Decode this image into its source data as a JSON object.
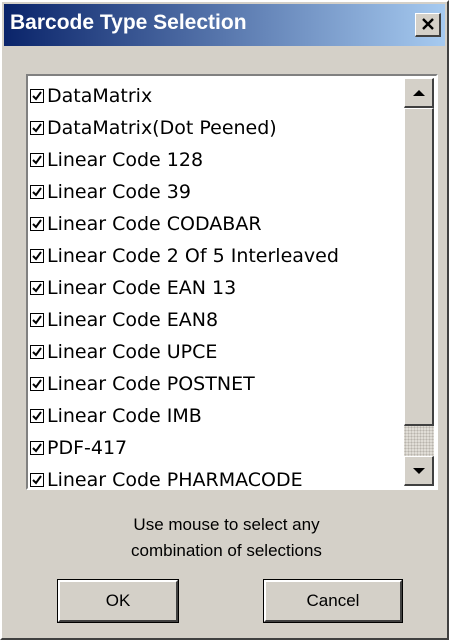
{
  "window": {
    "title": "Barcode Type Selection"
  },
  "list": {
    "items": [
      {
        "label": "DataMatrix",
        "checked": true
      },
      {
        "label": "DataMatrix(Dot Peened)",
        "checked": true
      },
      {
        "label": "Linear Code 128",
        "checked": true
      },
      {
        "label": "Linear Code 39",
        "checked": true
      },
      {
        "label": "Linear Code CODABAR",
        "checked": true
      },
      {
        "label": "Linear Code 2 Of 5 Interleaved",
        "checked": true
      },
      {
        "label": "Linear Code EAN 13",
        "checked": true
      },
      {
        "label": "Linear Code EAN8",
        "checked": true
      },
      {
        "label": "Linear Code UPCE",
        "checked": true
      },
      {
        "label": "Linear Code POSTNET",
        "checked": true
      },
      {
        "label": "Linear Code IMB",
        "checked": true
      },
      {
        "label": "PDF-417",
        "checked": true
      },
      {
        "label": "Linear Code PHARMACODE",
        "checked": true
      }
    ]
  },
  "hint": {
    "line1": "Use mouse to select any",
    "line2": "combination of selections"
  },
  "buttons": {
    "ok": "OK",
    "cancel": "Cancel"
  },
  "icons": {
    "close": "close-icon",
    "scroll_up": "arrow-up-icon",
    "scroll_down": "arrow-down-icon",
    "check": "checkmark-icon"
  },
  "colors": {
    "titlebar_start": "#0a246a",
    "titlebar_end": "#a6caf0",
    "face": "#d4d0c8"
  }
}
